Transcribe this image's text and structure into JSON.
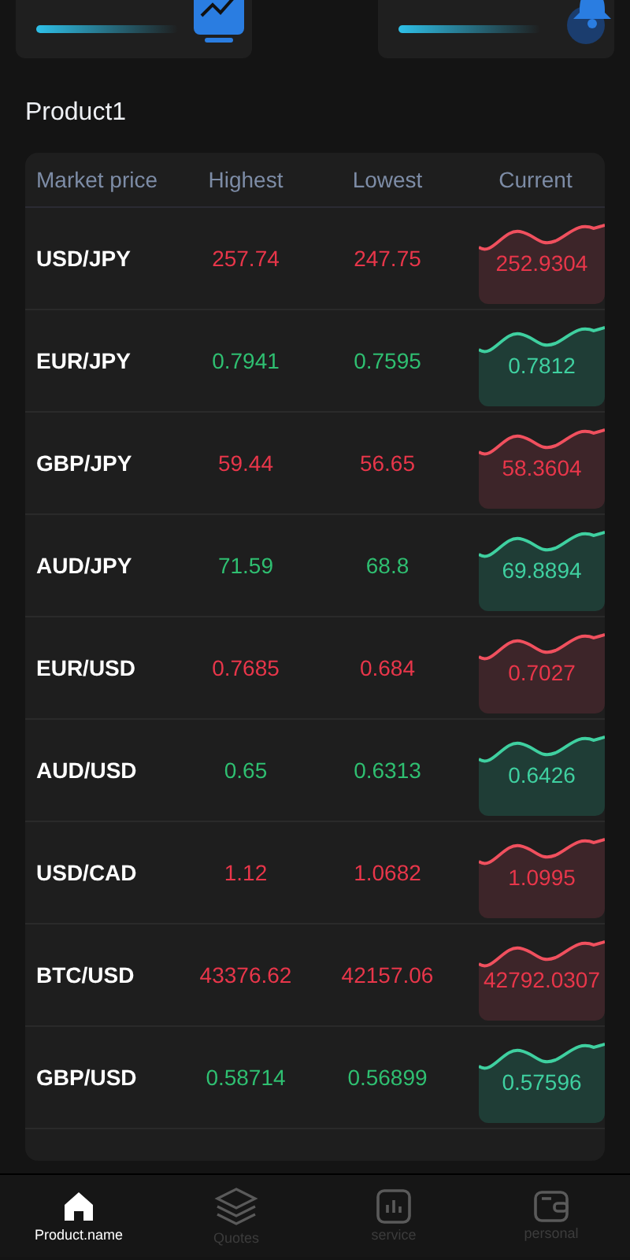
{
  "section_title": "Product1",
  "table": {
    "columns": [
      "Market price",
      "Highest",
      "Lowest",
      "Current"
    ],
    "rows": [
      {
        "pair": "USD/JPY",
        "highest": "257.74",
        "lowest": "247.75",
        "current": "252.9304",
        "kind": "down"
      },
      {
        "pair": "EUR/JPY",
        "highest": "0.7941",
        "lowest": "0.7595",
        "current": "0.7812",
        "kind": "up"
      },
      {
        "pair": "GBP/JPY",
        "highest": "59.44",
        "lowest": "56.65",
        "current": "58.3604",
        "kind": "down"
      },
      {
        "pair": "AUD/JPY",
        "highest": "71.59",
        "lowest": "68.8",
        "current": "69.8894",
        "kind": "up"
      },
      {
        "pair": "EUR/USD",
        "highest": "0.7685",
        "lowest": "0.684",
        "current": "0.7027",
        "kind": "down"
      },
      {
        "pair": "AUD/USD",
        "highest": "0.65",
        "lowest": "0.6313",
        "current": "0.6426",
        "kind": "up"
      },
      {
        "pair": "USD/CAD",
        "highest": "1.12",
        "lowest": "1.0682",
        "current": "1.0995",
        "kind": "down"
      },
      {
        "pair": "BTC/USD",
        "highest": "43376.62",
        "lowest": "42157.06",
        "current": "42792.0307",
        "kind": "down"
      },
      {
        "pair": "GBP/USD",
        "highest": "0.58714",
        "lowest": "0.56899",
        "current": "0.57596",
        "kind": "up"
      }
    ]
  },
  "tab_bar": [
    {
      "label": "Product.name",
      "kind": "home",
      "selected": true
    },
    {
      "label": "Quotes",
      "kind": "layers",
      "selected": false
    },
    {
      "label": "service",
      "kind": "chart",
      "selected": false
    },
    {
      "label": "personal",
      "kind": "wallet",
      "selected": false
    }
  ]
}
